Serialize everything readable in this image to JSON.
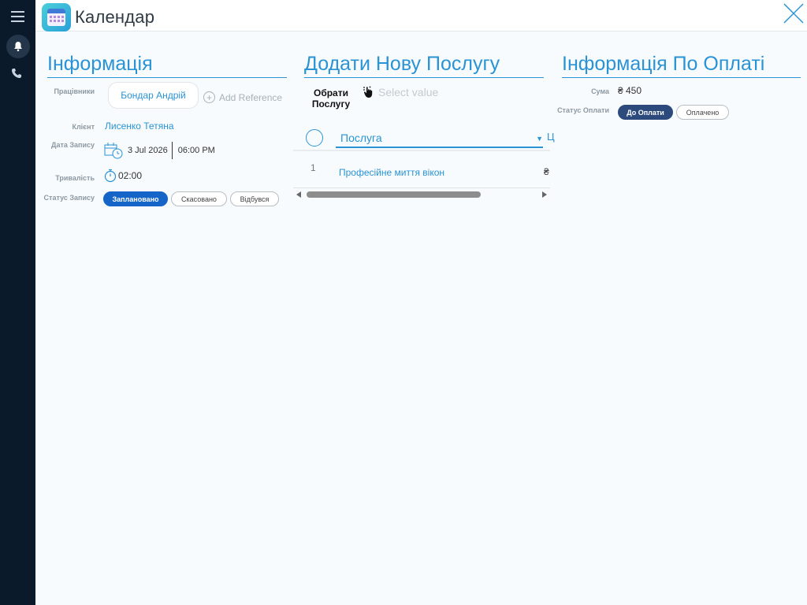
{
  "header": {
    "title": "Календар"
  },
  "sidebar": {
    "icons": [
      "menu-icon",
      "bell-icon",
      "phone-icon"
    ]
  },
  "info": {
    "title": "Інформація",
    "employees_label": "Працівники",
    "employee_name": "Бондар Андрій",
    "add_reference": "Add Reference",
    "client_label": "Клієнт",
    "client_name": "Лисенко Тетяна",
    "date_label": "Дата Запису",
    "date": "3 Jul 2026",
    "time": "06:00 PM",
    "duration_label": "Тривалість",
    "duration": "02:00",
    "status_label": "Статус Запису",
    "statuses": [
      "Заплановано",
      "Скасовано",
      "Відбувся"
    ],
    "selected_status": "Заплановано"
  },
  "service": {
    "title": "Додати Нову Послугу",
    "select_label": "Обрати Послугу",
    "select_placeholder": "Select value",
    "column_header": "Послуга",
    "column_next": "Ц",
    "rows": [
      {
        "num": "1",
        "name": "Професійне миття вікон",
        "price_prefix": "₴"
      }
    ]
  },
  "payment": {
    "title": "Інформація По Оплаті",
    "sum_label": "Сума",
    "sum": "₴ 450",
    "status_label": "Статус Оплати",
    "statuses": [
      "До Оплати",
      "Оплачено"
    ],
    "selected_status": "До Оплати"
  },
  "colors": {
    "accent": "#2a93d5",
    "primary_button": "#1565c9",
    "payment_button": "#2c4a7c",
    "sidebar": "#0b1a2b"
  }
}
